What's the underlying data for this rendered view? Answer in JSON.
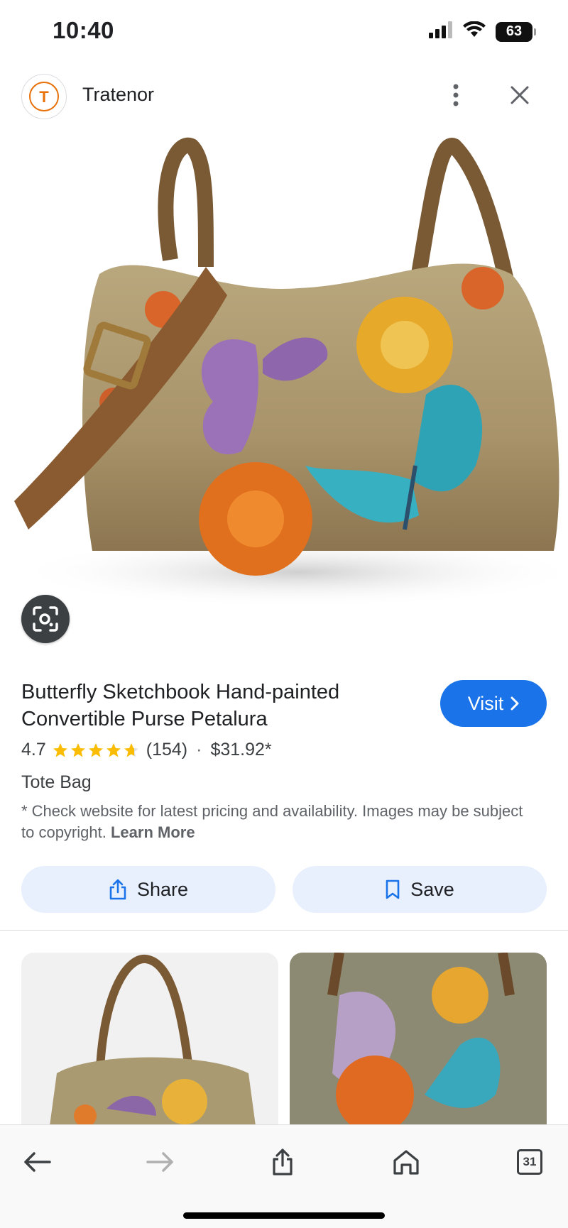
{
  "status_bar": {
    "time": "10:40",
    "battery": "63",
    "icons": [
      "cellular-signal-icon",
      "wifi-icon",
      "battery-icon"
    ]
  },
  "header": {
    "logo_letter": "T",
    "site_name": "Tratenor",
    "icons": [
      "more-vert-icon",
      "close-icon"
    ]
  },
  "hero": {
    "icon": "lens-search-icon"
  },
  "product": {
    "title": "Butterfly Sketchbook Hand-painted Convertible Purse Petalura",
    "visit_label": "Visit",
    "rating": "4.7",
    "stars": 4.7,
    "review_count": "(154)",
    "separator": "·",
    "price": "$31.92*",
    "category": "Tote Bag",
    "disclaimer": "* Check website for latest pricing and availability. Images may be subject to copyright.",
    "learn_more": "Learn More"
  },
  "actions": {
    "share_label": "Share",
    "save_label": "Save"
  },
  "bottom_nav": {
    "items": [
      "back-icon",
      "forward-icon",
      "share-icon",
      "home-icon",
      "tabs-icon"
    ],
    "tabs_count": "31"
  },
  "colors": {
    "accent": "#1a73e8",
    "button_tint": "#e8f0fe",
    "star": "#fbbc04",
    "logo_orange": "#e8710a"
  }
}
